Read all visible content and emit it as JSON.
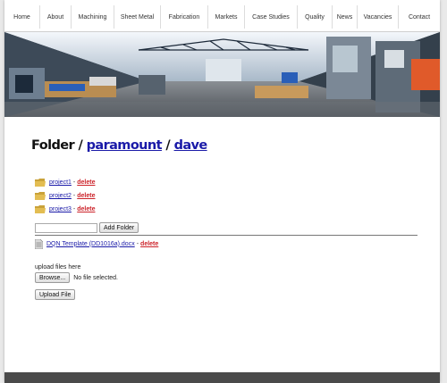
{
  "nav": {
    "items": [
      {
        "label": "Home"
      },
      {
        "label": "About"
      },
      {
        "label": "Machining"
      },
      {
        "label": "Sheet Metal"
      },
      {
        "label": "Fabrication"
      },
      {
        "label": "Markets"
      },
      {
        "label": "Case Studies"
      },
      {
        "label": "Quality"
      },
      {
        "label": "News"
      },
      {
        "label": "Vacancies"
      },
      {
        "label": "Contact"
      }
    ]
  },
  "heading": {
    "prefix": "Folder / ",
    "crumb1": "paramount",
    "sep": " / ",
    "crumb2": "dave"
  },
  "folders": [
    {
      "name": "project1",
      "delete_label": "delete"
    },
    {
      "name": "project2",
      "delete_label": "delete"
    },
    {
      "name": "project3",
      "delete_label": "delete"
    }
  ],
  "separator": "-",
  "add_folder": {
    "input_value": "",
    "button_label": "Add Folder"
  },
  "files": [
    {
      "name": "DQN Template (DD1016a).docx",
      "delete_label": "delete"
    }
  ],
  "upload": {
    "label": "upload files here",
    "browse_label": "Browse...",
    "no_file_text": "No file selected.",
    "button_label": "Upload File"
  },
  "colors": {
    "link": "#1a1aa8",
    "delete": "#cc2229",
    "footer": "#4a4a4a"
  }
}
